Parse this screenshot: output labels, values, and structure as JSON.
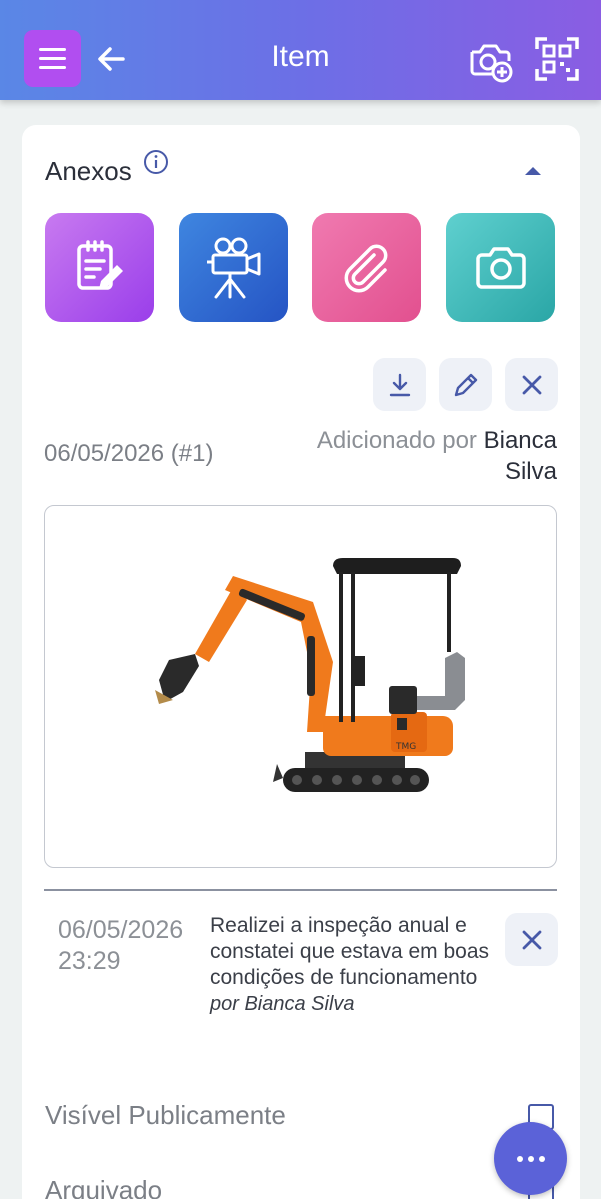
{
  "header": {
    "title": "Item",
    "icons": [
      "menu-icon",
      "back-arrow-icon",
      "camera-add-icon",
      "qr-scan-icon"
    ],
    "menu_color": "#b14ef0"
  },
  "attachments": {
    "section_title": "Anexos",
    "buttons": [
      {
        "name": "note",
        "icon": "note-edit-icon"
      },
      {
        "name": "video",
        "icon": "video-camera-icon"
      },
      {
        "name": "file",
        "icon": "paperclip-icon"
      },
      {
        "name": "photo",
        "icon": "camera-icon"
      }
    ],
    "item": {
      "date": "06/05/2026 (#1)",
      "added_by_label": "Adicionado por",
      "added_by_name": "Bianca Silva",
      "actions": [
        "download-icon",
        "pencil-icon",
        "close-icon"
      ]
    }
  },
  "comment": {
    "date": "06/05/2026",
    "time": "23:29",
    "text": "Realizei a inspeção anual e constatei que estava em boas condições de funcionamento",
    "author": "por Bianca Silva"
  },
  "options": {
    "public_label": "Visível Publicamente",
    "archived_label": "Arquivado",
    "public_checked": false,
    "archived_checked": false
  },
  "colors": {
    "accent": "#5b62d8",
    "header_gradient_start": "#5a87e6",
    "header_gradient_end": "#8a5de3"
  }
}
